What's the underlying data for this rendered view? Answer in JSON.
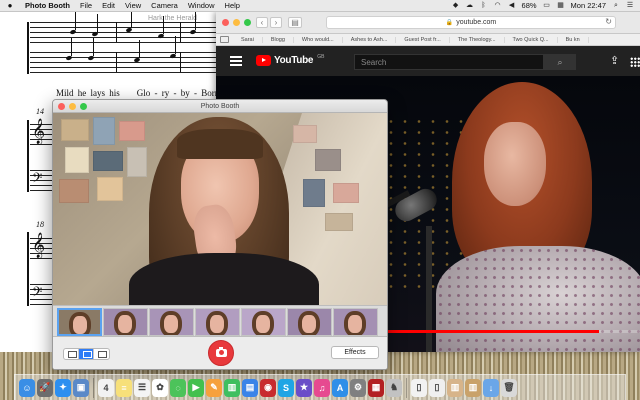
{
  "menubar": {
    "app_name": "Photo Booth",
    "items": [
      "File",
      "Edit",
      "View",
      "Camera",
      "Window",
      "Help"
    ],
    "battery": "68%",
    "clock": "Mon 22:47"
  },
  "sheet_music": {
    "document_title": "Hark the Herald",
    "lyrics": [
      "Mild",
      "he",
      "lays",
      "his",
      "Glo",
      "ry",
      "by",
      "Born"
    ],
    "measure_numbers": [
      "14",
      "18"
    ]
  },
  "safari": {
    "url": "youtube.com",
    "bookmarks": [
      "Sarai",
      "Blogg",
      "Who would...",
      "Ashes to Ash...",
      "Guest Post fr...",
      "The Theology...",
      "Two Quick Q...",
      "Bu kn"
    ],
    "youtube": {
      "logo_text": "YouTube",
      "region": "GB",
      "search_placeholder": "Search",
      "progress_fraction": 0.84,
      "accent": "#ff0000"
    }
  },
  "photo_booth": {
    "title": "Photo Booth",
    "effects_label": "Effects",
    "thumbnail_count": 7,
    "shutter_color": "#e8393c"
  },
  "dock": {
    "icons": [
      {
        "name": "finder-icon",
        "color": "#3a8ee6",
        "glyph": "☺"
      },
      {
        "name": "launchpad-icon",
        "color": "#6d6d6d",
        "glyph": "🚀"
      },
      {
        "name": "safari-icon",
        "color": "#2d8ff0",
        "glyph": "✦"
      },
      {
        "name": "preview-icon",
        "color": "#5a89c8",
        "glyph": "▣"
      },
      {
        "name": "sep",
        "color": "",
        "glyph": ""
      },
      {
        "name": "calendar-icon",
        "color": "#f2f2f2",
        "glyph": "4"
      },
      {
        "name": "notes-icon",
        "color": "#f7e07a",
        "glyph": "≡"
      },
      {
        "name": "reminders-icon",
        "color": "#f4f4f4",
        "glyph": "☰"
      },
      {
        "name": "photos-icon",
        "color": "#ffffff",
        "glyph": "✿"
      },
      {
        "name": "messages-icon",
        "color": "#4cc35a",
        "glyph": "◌"
      },
      {
        "name": "facetime-icon",
        "color": "#43c04e",
        "glyph": "▶"
      },
      {
        "name": "pages-icon",
        "color": "#f6a13d",
        "glyph": "✎"
      },
      {
        "name": "numbers-icon",
        "color": "#3fbf5f",
        "glyph": "▥"
      },
      {
        "name": "keynote-icon",
        "color": "#3a84e8",
        "glyph": "▤"
      },
      {
        "name": "photo-booth-icon",
        "color": "#c82b2e",
        "glyph": "◉"
      },
      {
        "name": "skype-icon",
        "color": "#1fa5e5",
        "glyph": "S"
      },
      {
        "name": "imovie-icon",
        "color": "#6a4ec8",
        "glyph": "★"
      },
      {
        "name": "itunes-icon",
        "color": "#e64a90",
        "glyph": "♫"
      },
      {
        "name": "app-store-icon",
        "color": "#2f8fe8",
        "glyph": "A"
      },
      {
        "name": "system-preferences-icon",
        "color": "#808080",
        "glyph": "⚙"
      },
      {
        "name": "photo-booth-app-icon",
        "color": "#b32022",
        "glyph": "▦"
      },
      {
        "name": "game-icon",
        "color": "#c2c2c2",
        "glyph": "♞"
      },
      {
        "name": "sep",
        "color": "",
        "glyph": ""
      },
      {
        "name": "document-icon",
        "color": "#f2f2f2",
        "glyph": "▯"
      },
      {
        "name": "document-icon-2",
        "color": "#efefef",
        "glyph": "▯"
      },
      {
        "name": "downloads-stack-icon",
        "color": "#d7b48a",
        "glyph": "▥"
      },
      {
        "name": "desktop-stack-icon",
        "color": "#c9a26a",
        "glyph": "▥"
      },
      {
        "name": "downloads-folder-icon",
        "color": "#6aa6e8",
        "glyph": "↓"
      },
      {
        "name": "trash-icon",
        "color": "#d9d9d9",
        "glyph": "🗑"
      }
    ]
  }
}
